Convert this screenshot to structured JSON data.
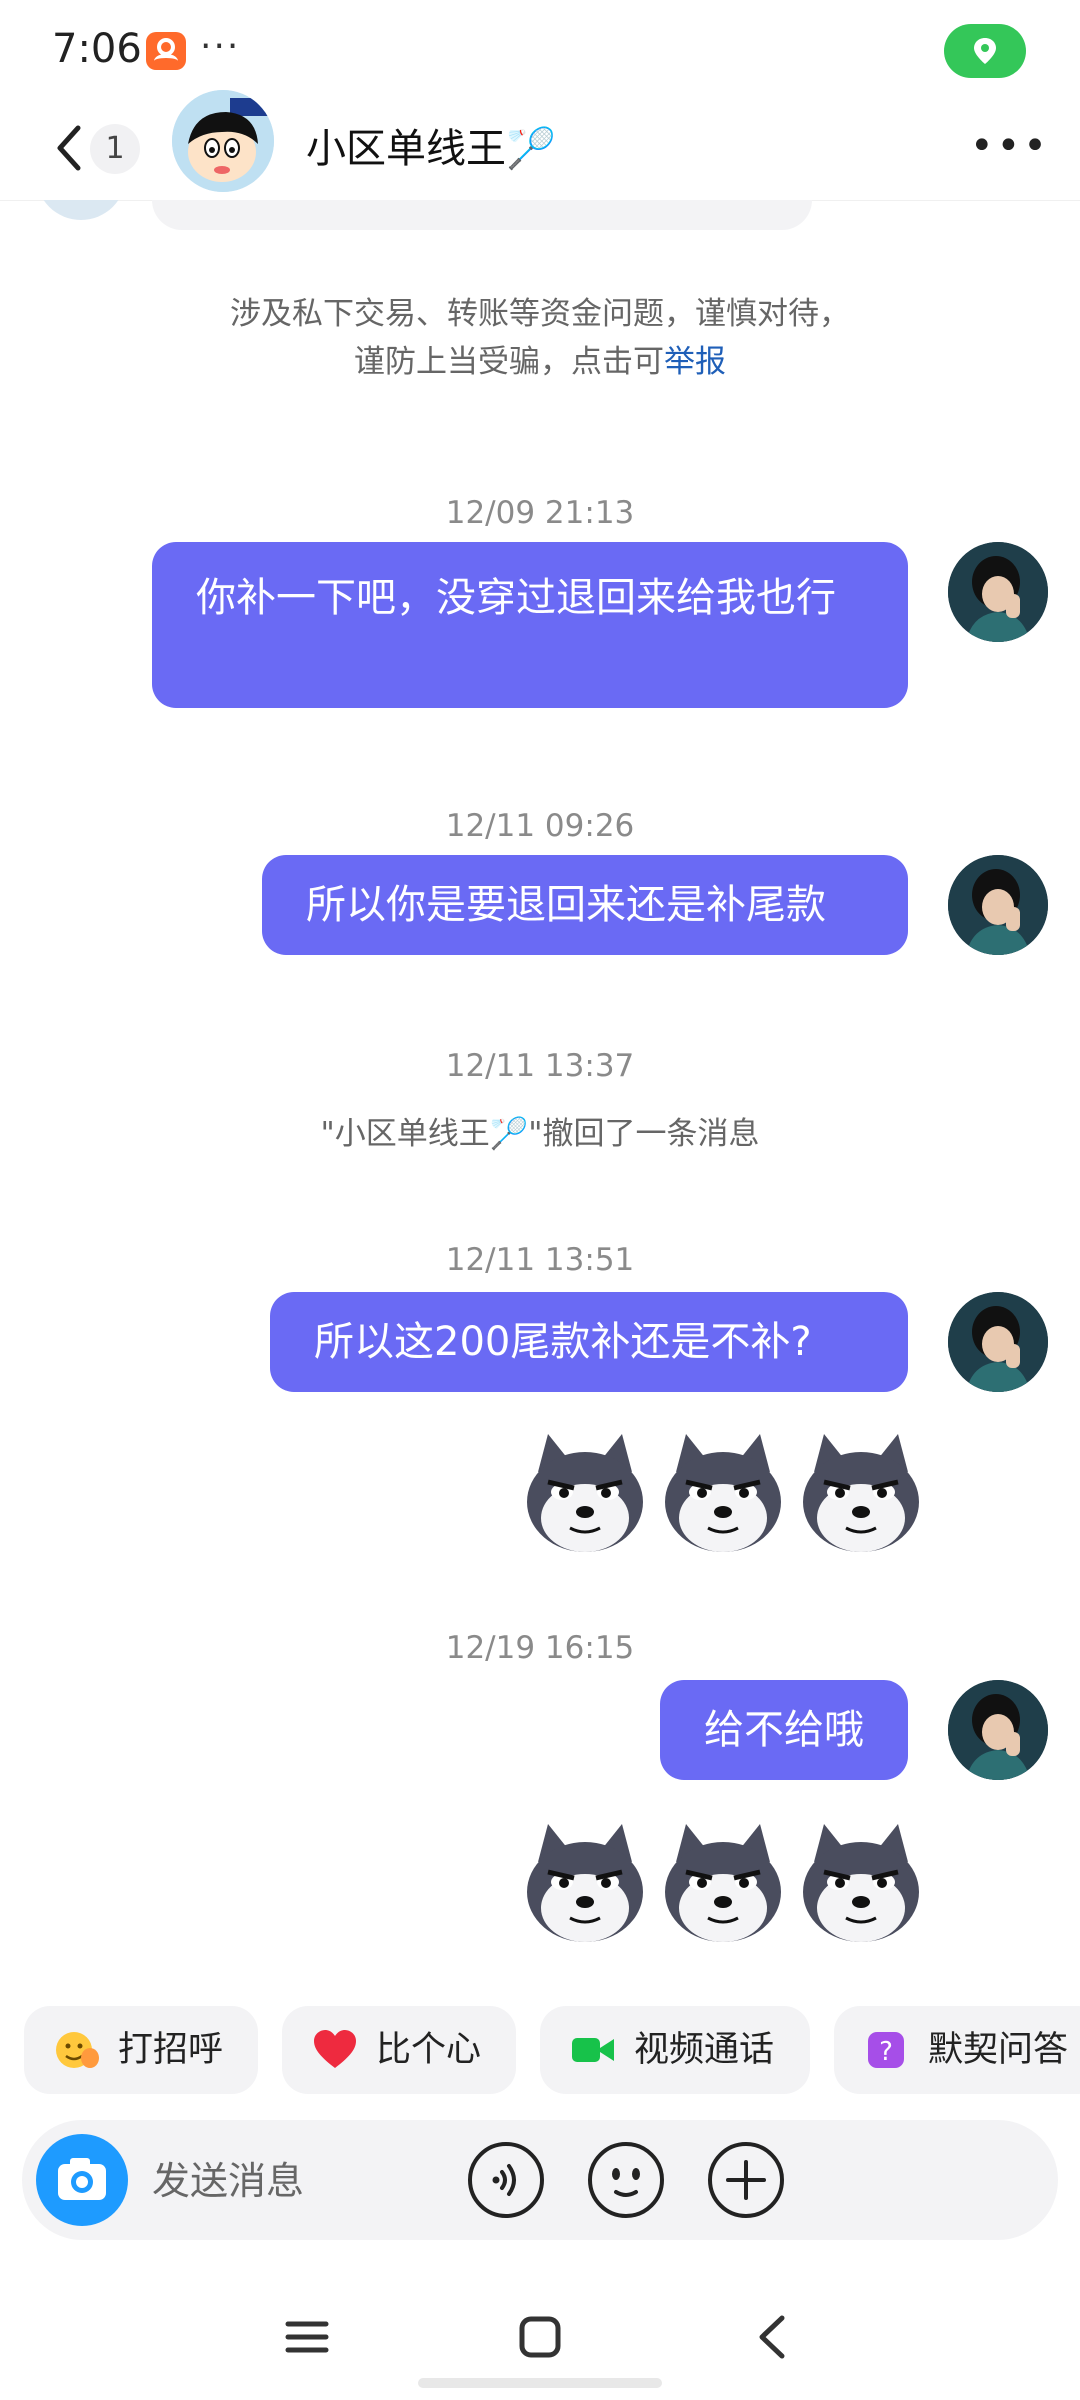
{
  "status_bar": {
    "time": "7:06",
    "more_dots": "···",
    "location_pill_color": "#34c759"
  },
  "header": {
    "unread_count": "1",
    "title": "小区单线王",
    "title_emoji": "🏸",
    "more_label": "•••"
  },
  "notice": {
    "text": "涉及私下交易、转账等资金问题，谨慎对待，谨防上当受骗，点击可",
    "link": "举报"
  },
  "messages": [
    {
      "timestamp": "12/09 21:13",
      "text": "你补一下吧，没穿过退回来给我也行"
    },
    {
      "timestamp": "12/11 09:26",
      "text": "所以你是要退回来还是补尾款"
    },
    {
      "timestamp": "12/11 13:37",
      "system": "\"小区单线王🏸\"撤回了一条消息"
    },
    {
      "timestamp": "12/11 13:51",
      "text": "所以这200尾款补还是不补?"
    },
    {
      "timestamp": "12/19 16:15",
      "text": "给不给哦"
    }
  ],
  "quick_actions": [
    {
      "label": "打招呼",
      "icon": "wave-emoji-icon"
    },
    {
      "label": "比个心",
      "icon": "heart-icon"
    },
    {
      "label": "视频通话",
      "icon": "video-camera-icon"
    },
    {
      "label": "默契问答",
      "icon": "question-box-icon"
    }
  ],
  "input": {
    "placeholder": "发送消息"
  },
  "colors": {
    "bubble": "#6a6af4",
    "link": "#1f5fb8",
    "camera": "#1e9bff"
  }
}
